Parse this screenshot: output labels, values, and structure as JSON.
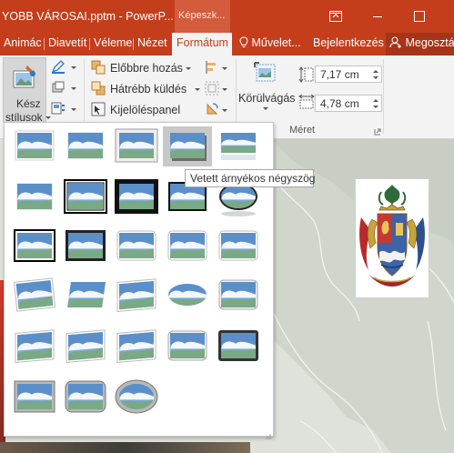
{
  "window": {
    "title": "YOBB VÁROSAI.pptm - PowerP...",
    "context_group": "Képeszk...",
    "restore_icon": "restore-window-icon",
    "maximize_icon": "maximize-icon"
  },
  "tabs": {
    "items": [
      "Animác",
      "Diavetít",
      "Véleme",
      "Nézet"
    ],
    "active": "Formátum",
    "tell_me": "Művelet...",
    "sign_in": "Bejelentkezés",
    "share": "Megosztás"
  },
  "ribbon": {
    "quick_styles_line1": "Kész",
    "quick_styles_line2": "stílusok",
    "bring_forward": "Előbbre hozás",
    "send_backward": "Hátrébb küldés",
    "selection_pane": "Kijelöléspanel",
    "crop": "Körülvágás",
    "height_value": "7,17 cm",
    "width_value": "4,78 cm",
    "size_group": "Méret"
  },
  "gallery": {
    "tooltip": "Vetett árnyékos négyszög",
    "selected_index": 3,
    "styles": [
      "simple-frame-white",
      "soft-edge-rectangle",
      "beveled-matte-white",
      "drop-shadow-rectangle",
      "reflected-rounded-rectangle",
      "soft-edge-rectangle-2",
      "double-frame-black",
      "thick-matte-black",
      "simple-frame-black",
      "beveled-oval-black",
      "compound-frame-black",
      "center-shadow-rectangle",
      "rounded-diagonal-corner-white",
      "snip-diagonal-corner-white",
      "moderate-frame-white",
      "rotated-white",
      "perspective-shadow-white",
      "relaxed-perspective-white",
      "soft-edge-oval",
      "bevel-rectangle",
      "bevel-perspective",
      "reflected-perspective-right",
      "bevel-perspective-left-white",
      "reflected-bevel-white",
      "reflected-bevel-black",
      "metal-frame",
      "metal-rounded-rectangle",
      "metal-oval"
    ]
  },
  "colors": {
    "accent": "#c43e1c",
    "ribbon_bg": "#f3f3f3",
    "sky": "#5b9bd5",
    "land": "#7aa985"
  }
}
